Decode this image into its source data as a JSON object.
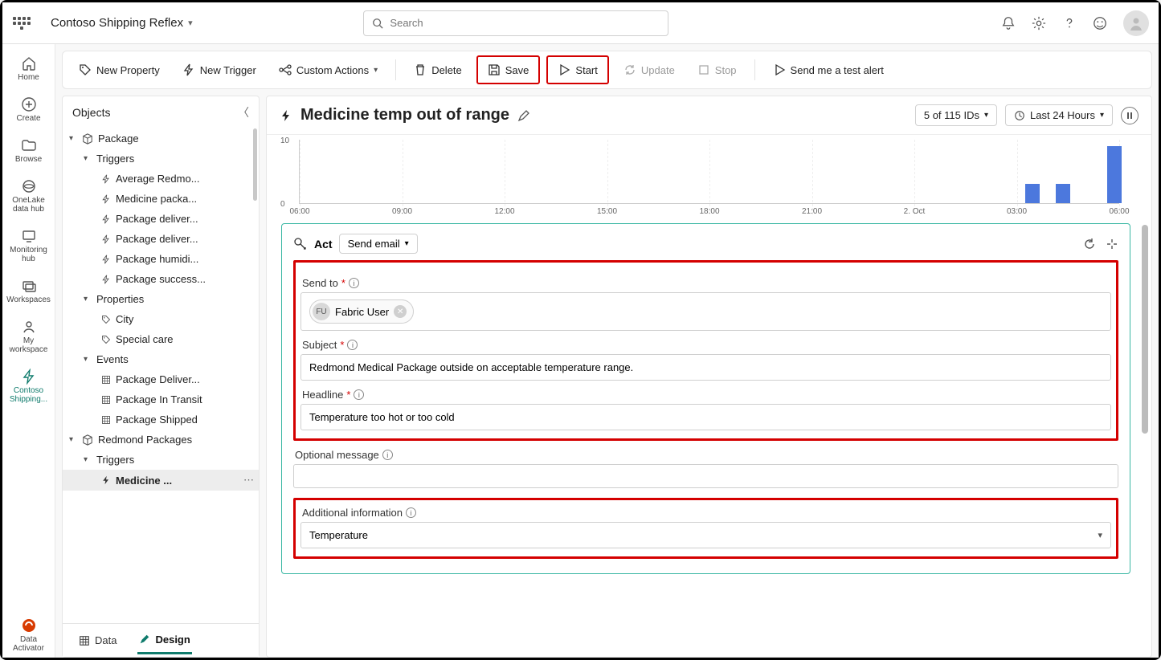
{
  "app": {
    "title": "Contoso Shipping Reflex"
  },
  "search": {
    "placeholder": "Search"
  },
  "rail": {
    "home": "Home",
    "create": "Create",
    "browse": "Browse",
    "onelake": "OneLake data hub",
    "monitoring": "Monitoring hub",
    "workspaces": "Workspaces",
    "my_workspace": "My workspace",
    "current": "Contoso Shipping...",
    "activator": "Data Activator"
  },
  "toolbar": {
    "new_property": "New Property",
    "new_trigger": "New Trigger",
    "custom_actions": "Custom Actions",
    "delete": "Delete",
    "save": "Save",
    "start": "Start",
    "update": "Update",
    "stop": "Stop",
    "send_test": "Send me a test alert"
  },
  "objects": {
    "title": "Objects",
    "package": "Package",
    "triggers_label": "Triggers",
    "properties_label": "Properties",
    "events_label": "Events",
    "triggers": [
      "Average Redmo...",
      "Medicine packa...",
      "Package deliver...",
      "Package deliver...",
      "Package humidi...",
      "Package success..."
    ],
    "properties": [
      "City",
      "Special care"
    ],
    "events": [
      "Package Deliver...",
      "Package In Transit",
      "Package Shipped"
    ],
    "redmond": "Redmond Packages",
    "redmond_trigger": "Medicine ..."
  },
  "designer": {
    "title": "Medicine temp out of range",
    "ids_pill": "5 of 115 IDs",
    "time_pill": "Last 24 Hours",
    "act_label": "Act",
    "act_action": "Send email",
    "labels": {
      "send_to": "Send to",
      "subject": "Subject",
      "headline": "Headline",
      "optional_msg": "Optional message",
      "additional_info": "Additional information"
    },
    "send_to_user": {
      "initials": "FU",
      "name": "Fabric User"
    },
    "subject_value": "Redmond Medical Package outside on acceptable temperature range.",
    "headline_value": "Temperature too hot or too cold",
    "optional_value": "",
    "additional_value": "Temperature"
  },
  "bottom": {
    "data": "Data",
    "design": "Design"
  },
  "chart_data": {
    "type": "bar",
    "ylim": [
      0,
      10
    ],
    "yticks": [
      0,
      10
    ],
    "xticks": [
      "06:00",
      "09:00",
      "12:00",
      "15:00",
      "18:00",
      "21:00",
      "2. Oct",
      "03:00",
      "06:00"
    ],
    "bars": [
      {
        "x_index_partial": 7.15,
        "value": 3
      },
      {
        "x_index_partial": 7.45,
        "value": 3
      },
      {
        "x_index_partial": 7.95,
        "value": 9
      }
    ]
  }
}
